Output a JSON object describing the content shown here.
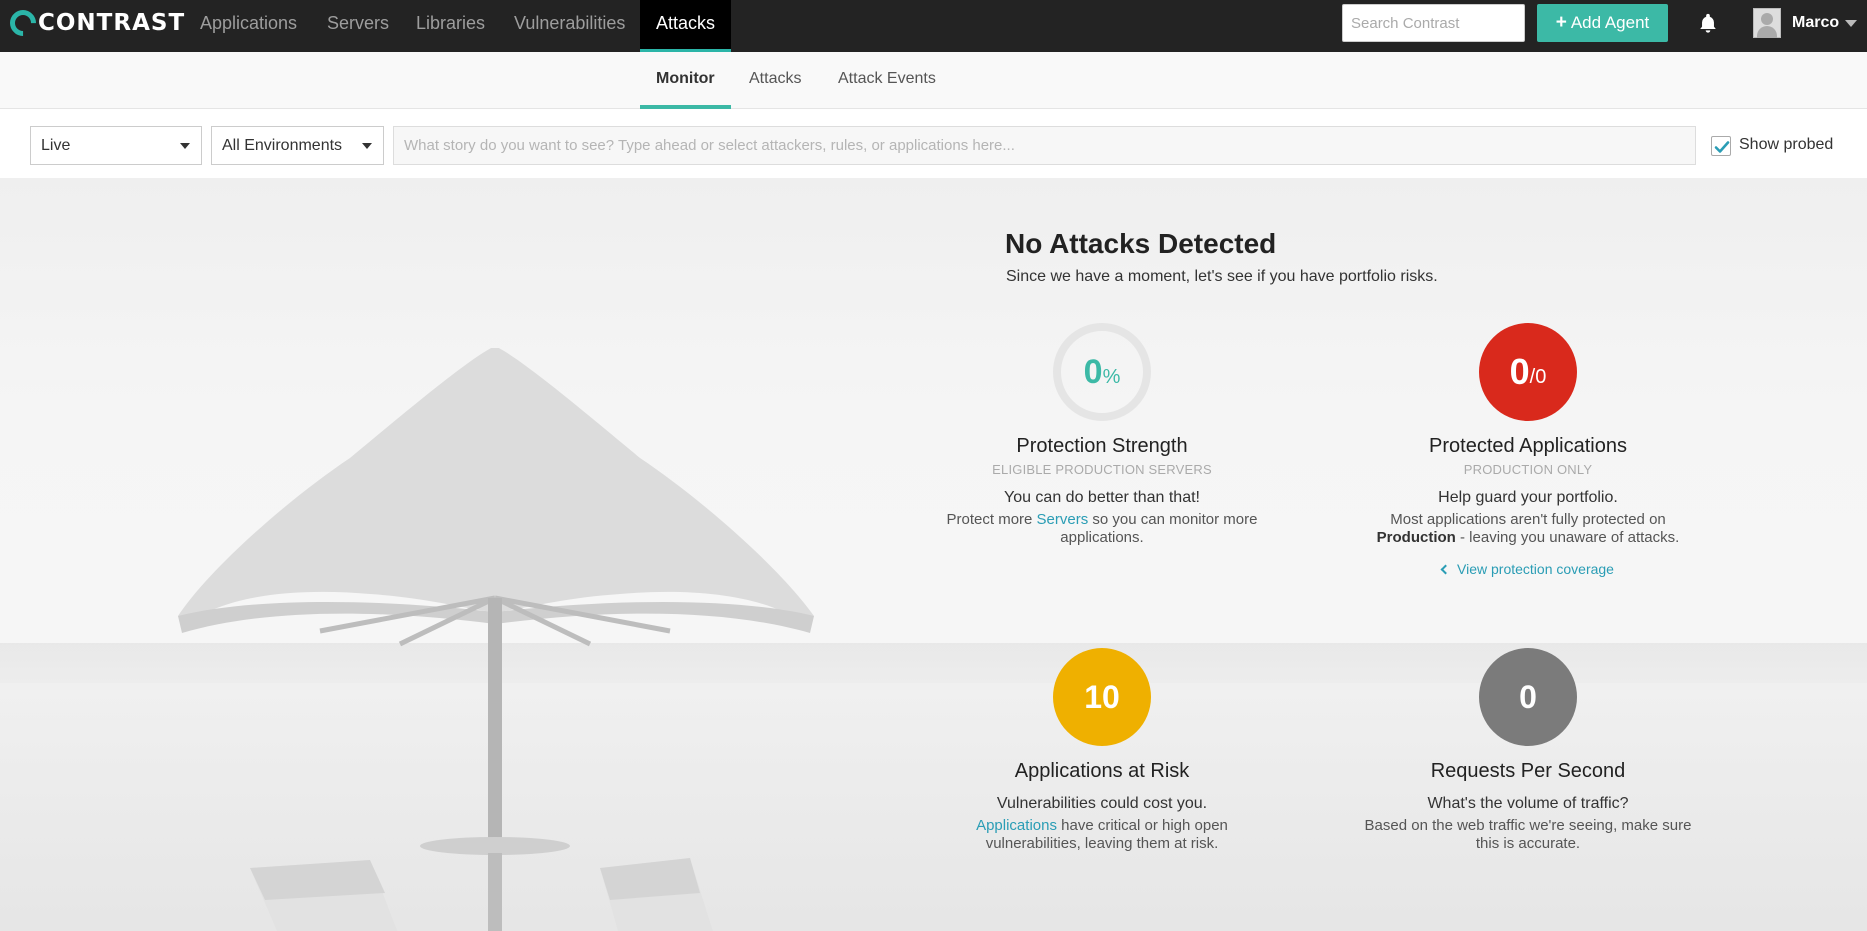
{
  "topnav": {
    "logo": "CONTRAST",
    "items": [
      {
        "label": "Applications"
      },
      {
        "label": "Servers"
      },
      {
        "label": "Libraries"
      },
      {
        "label": "Vulnerabilities"
      },
      {
        "label": "Attacks"
      }
    ],
    "search_placeholder": "Search Contrast",
    "add_agent_label": "Add Agent",
    "username": "Marco"
  },
  "subnav": {
    "tabs": [
      {
        "label": "Monitor"
      },
      {
        "label": "Attacks"
      },
      {
        "label": "Attack Events"
      }
    ]
  },
  "filters": {
    "time_select": "Live",
    "env_select": "All Environments",
    "story_placeholder": "What story do you want to see? Type ahead or select attackers, rules, or applications here...",
    "show_probed_label": "Show probed",
    "show_probed_checked": true
  },
  "hero": {
    "headline": "No Attacks Detected",
    "subline": "Since we have a moment, let's see if you have portfolio risks.",
    "cards": {
      "protection_strength": {
        "value": "0",
        "unit": "%",
        "title": "Protection Strength",
        "subtitle": "ELIGIBLE PRODUCTION SERVERS",
        "lead": "You can do better than that!",
        "body_pre": "Protect more ",
        "body_link": "Servers",
        "body_post": " so you can monitor more applications."
      },
      "protected_applications": {
        "value": "0",
        "unit": "/0",
        "title": "Protected Applications",
        "subtitle": "PRODUCTION ONLY",
        "lead": "Help guard your portfolio.",
        "body_pre": "Most applications aren't fully protected on ",
        "body_bold": "Production",
        "body_post": " - leaving you unaware of attacks.",
        "link": "View protection coverage"
      },
      "applications_at_risk": {
        "value": "10",
        "title": "Applications at Risk",
        "lead": "Vulnerabilities could cost you.",
        "body_link": "Applications",
        "body_post": " have critical or high open vulnerabilities, leaving them at risk."
      },
      "requests_per_second": {
        "value": "0",
        "title": "Requests Per Second",
        "lead": "What's the volume of traffic?",
        "body": "Based on the web traffic we're seeing, make sure this is accurate."
      }
    }
  },
  "colors": {
    "accent": "#3cb9a6",
    "link": "#2a9db5",
    "danger": "#d9291c",
    "warning": "#efb000",
    "neutral": "#7b7b7b"
  }
}
